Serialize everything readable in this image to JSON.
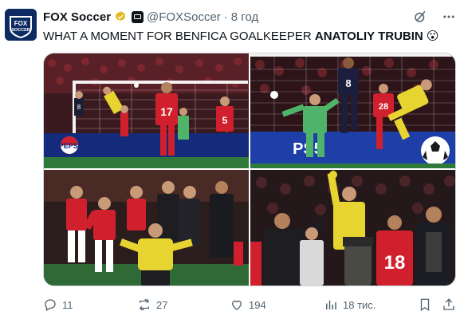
{
  "author": {
    "name": "FOX Soccer",
    "handle": "@FOXSoccer",
    "separator": "·",
    "time": "8 год",
    "avatar_text": "FOX SOCCER"
  },
  "tweet": {
    "text_prefix": "WHAT A MOMENT FOR BENFICA GOALKEEPER",
    "text_bold": "ANATOLIY TRUBIN",
    "emoji": "😮"
  },
  "photos": [
    {
      "jersey_numbers": [
        "8",
        "17",
        "5"
      ],
      "board_text": "PEPSI"
    },
    {
      "jersey_numbers": [
        "8",
        "28"
      ],
      "board_text": "PS5"
    },
    {
      "jersey_numbers": [],
      "board_text": ""
    },
    {
      "jersey_numbers": [
        "18"
      ],
      "board_text": ""
    }
  ],
  "actions": {
    "replies": "11",
    "retweets": "27",
    "likes": "194",
    "views": "18 тис."
  },
  "colors": {
    "text": "#0f1419",
    "muted": "#536471",
    "verified": "#e2b719",
    "benfica_red": "#d0202e",
    "keeper_yellow": "#e8d430",
    "keeper_green": "#4fb36a"
  }
}
